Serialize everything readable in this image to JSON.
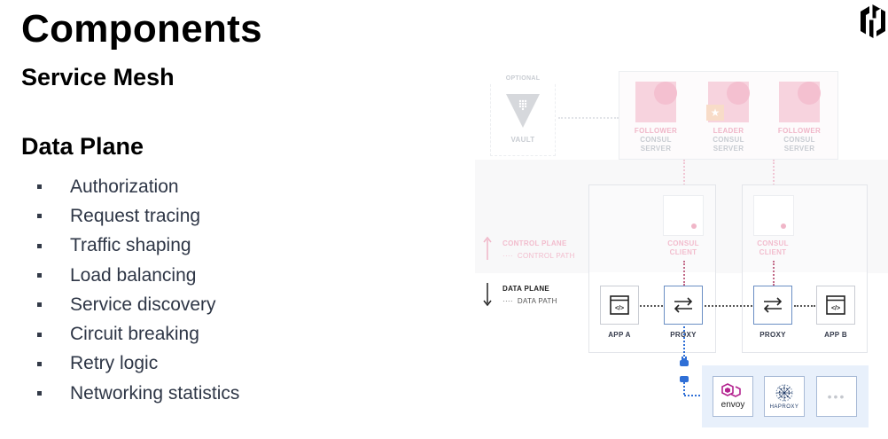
{
  "slide": {
    "title": "Components",
    "subtitle": "Service Mesh",
    "section_heading": "Data Plane",
    "bullets": [
      "Authorization",
      "Request tracing",
      "Traffic shaping",
      "Load balancing",
      "Service discovery",
      "Circuit breaking",
      "Retry logic",
      "Networking statistics"
    ]
  },
  "diagram": {
    "optional_label": "OPTIONAL",
    "vault_label": "VAULT",
    "servers": [
      {
        "role": "FOLLOWER",
        "line1": "CONSUL",
        "line2": "SERVER"
      },
      {
        "role": "LEADER",
        "line1": "CONSUL",
        "line2": "SERVER"
      },
      {
        "role": "FOLLOWER",
        "line1": "CONSUL",
        "line2": "SERVER"
      }
    ],
    "consul_client_line1": "CONSUL",
    "consul_client_line2": "CLIENT",
    "control_plane_label": "CONTROL PLANE",
    "control_path_label": "CONTROL PATH",
    "data_plane_label": "DATA PLANE",
    "data_path_label": "DATA PATH",
    "app_a_label": "APP A",
    "app_b_label": "APP B",
    "proxy_label": "PROXY",
    "envoy_label": "envoy",
    "haproxy_label": "HAPROXY",
    "more_label": "•••"
  },
  "colors": {
    "pink": "#f3c4d3",
    "blue_accent": "#2f6fd6",
    "proxy_bar": "#e8f0fb"
  }
}
